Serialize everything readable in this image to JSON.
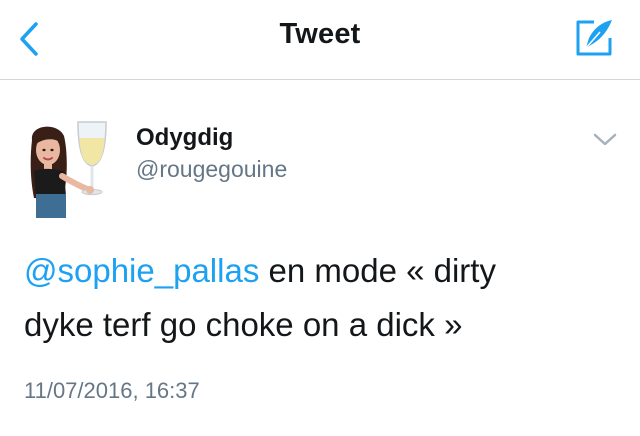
{
  "nav": {
    "title": "Tweet",
    "back_icon": "chevron-left-icon",
    "compose_icon": "compose-quill-icon",
    "accent_color": "#1da1f2"
  },
  "tweet": {
    "author": {
      "display_name": "Odygdig",
      "username": "@rougegouine",
      "avatar": "bitmoji-avatar-with-wine-glass"
    },
    "menu_icon": "chevron-down-icon",
    "mention": "@sophie_pallas",
    "text_line1": " en mode « dirty",
    "text_line2": "dyke terf go choke on a dick »",
    "timestamp": "11/07/2016, 16:37"
  },
  "colors": {
    "text": "#14171a",
    "secondary": "#657786",
    "link": "#1da1f2",
    "divider": "#d6d6d6"
  }
}
